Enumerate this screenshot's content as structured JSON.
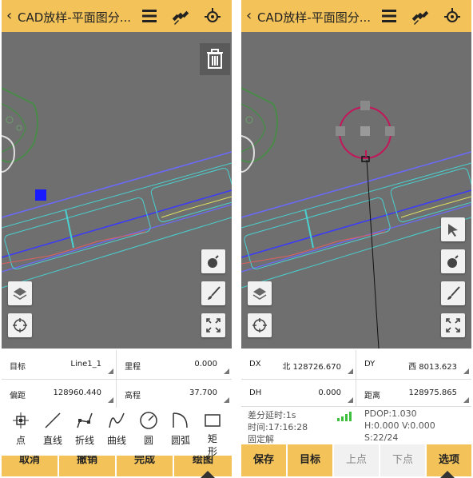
{
  "left": {
    "title": "CAD放样-平面图分...",
    "fields": [
      {
        "label": "目标",
        "value": "Line1_1"
      },
      {
        "label": "里程",
        "value": "0.000"
      },
      {
        "label": "偏距",
        "value": "128960.440"
      },
      {
        "label": "高程",
        "value": "37.700"
      }
    ],
    "tools": [
      {
        "label": "点",
        "icon": "point-icon"
      },
      {
        "label": "直线",
        "icon": "line-icon"
      },
      {
        "label": "折线",
        "icon": "polyline-icon"
      },
      {
        "label": "曲线",
        "icon": "curve-icon"
      },
      {
        "label": "圆",
        "icon": "circle-icon"
      },
      {
        "label": "圆弧",
        "icon": "arc-icon"
      },
      {
        "label": "矩",
        "label2": "形",
        "icon": "rectangle-icon"
      }
    ],
    "buttons": [
      "取消",
      "撤销",
      "完成",
      "绘图"
    ]
  },
  "right": {
    "title": "CAD放样-平面图分...",
    "fields": [
      {
        "label": "DX",
        "value": "北 128726.670"
      },
      {
        "label": "DY",
        "value": "西 8013.623"
      },
      {
        "label": "DH",
        "value": "0.000"
      },
      {
        "label": "距离",
        "value": "128975.865"
      }
    ],
    "gps": {
      "delay": "差分延时:1s",
      "time": "时间:17:16:28",
      "fix": "固定解",
      "pdop": "PDOP:1.030",
      "hv": "H:0.000  V:0.000",
      "sats": "S:22/24"
    },
    "buttons": [
      {
        "label": "保存",
        "enabled": true
      },
      {
        "label": "目标",
        "enabled": true
      },
      {
        "label": "上点",
        "enabled": false
      },
      {
        "label": "下点",
        "enabled": false
      },
      {
        "label": "选项",
        "enabled": true
      }
    ]
  },
  "colors": {
    "accent": "#f3c35a",
    "canvas": "#6f6f6f",
    "signal": "#3cbf3c",
    "selected_point": "#1a1aff",
    "target_ring": "#c2185b"
  }
}
